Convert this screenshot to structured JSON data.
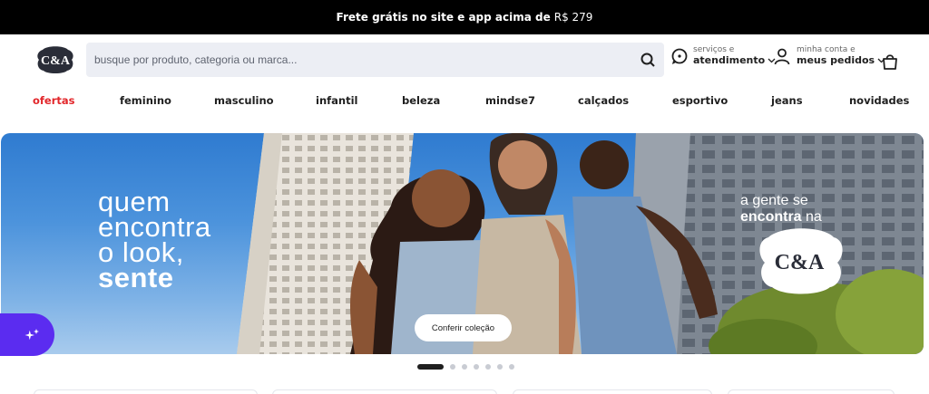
{
  "promo": {
    "text": "Frete grátis no site e app acima de",
    "price": "R$ 279"
  },
  "header": {
    "logo_text": "C&A",
    "search_placeholder": "busque por produto, categoria ou marca...",
    "search_icon": "search-icon",
    "services": {
      "small": "serviços e",
      "big": "atendimento"
    },
    "account": {
      "small": "minha conta e",
      "big": "meus pedidos"
    },
    "cart_icon": "bag-icon"
  },
  "nav": {
    "items": [
      "ofertas",
      "feminino",
      "masculino",
      "infantil",
      "beleza",
      "mindse7",
      "calçados",
      "esportivo",
      "jeans",
      "novidades"
    ],
    "highlight_color": "#e2262a"
  },
  "hero": {
    "line1": "quem",
    "line2": "encontra",
    "line3": "o look,",
    "line4": "sente",
    "tag_line1": "a gente se",
    "tag_strong": "encontra",
    "tag_rest": "na",
    "badge_text": "C&A",
    "cta": "Conferir coleção"
  },
  "carousel": {
    "count": 7,
    "active": 1
  },
  "colors": {
    "promo_bg": "#000000",
    "chat": "#5b2cf0",
    "sky": "#4c93dc"
  }
}
